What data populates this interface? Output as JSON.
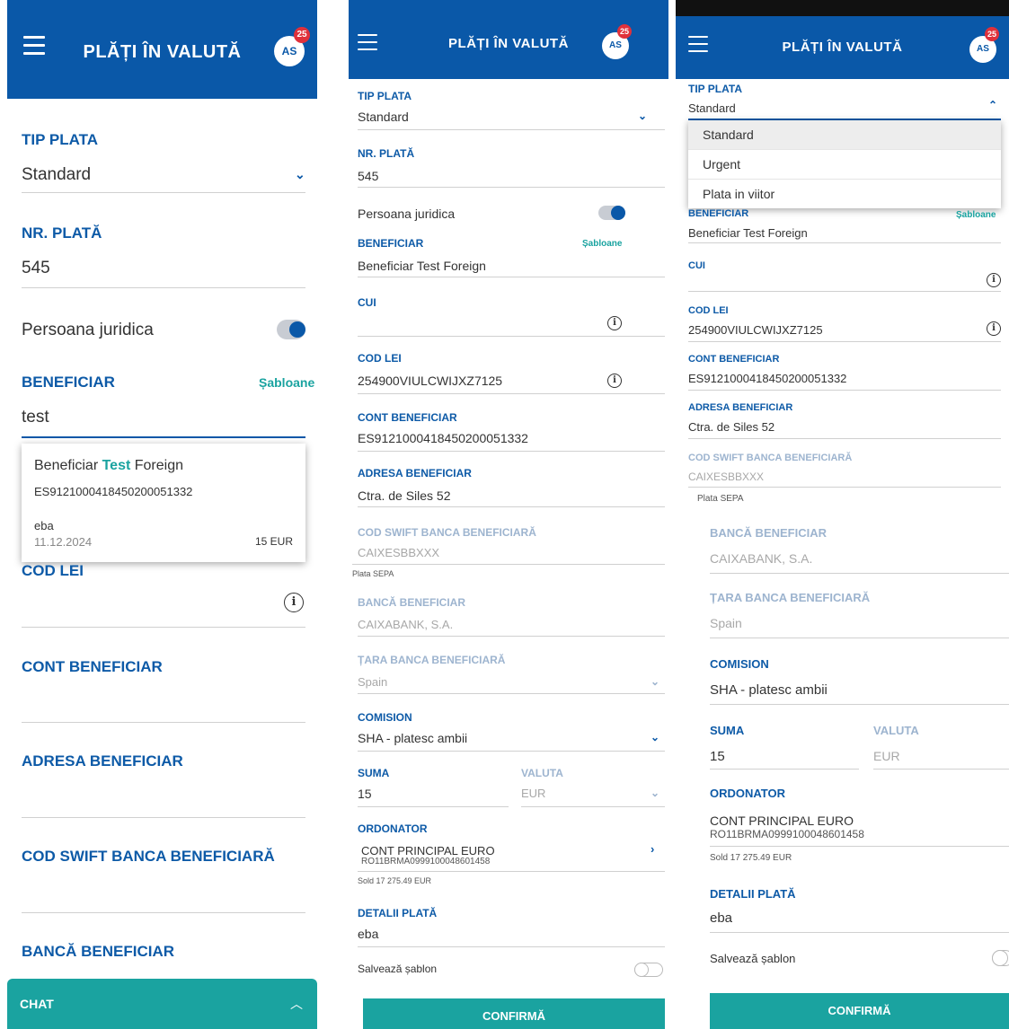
{
  "header": {
    "title": "PLĂȚI ÎN VALUTĂ",
    "avatar": "AS",
    "badge": "25"
  },
  "fields": {
    "tip_plata": {
      "label": "TIP PLATA",
      "value": "Standard"
    },
    "nr_plata": {
      "label": "NR. PLATĂ",
      "value": "545"
    },
    "persoana_juridica": {
      "label": "Persoana juridica",
      "enabled": true
    },
    "beneficiar": {
      "label": "BENEFICIAR",
      "value": "Beneficiar Test Foreign",
      "search_value": "test",
      "templates_link": "Șabloane"
    },
    "cui": {
      "label": "CUI",
      "value": ""
    },
    "cod_lei": {
      "label": "COD LEI",
      "value": "254900VIULCWIJXZ7125"
    },
    "cont_beneficiar": {
      "label": "CONT BENEFICIAR",
      "value": "ES9121000418450200051332"
    },
    "adresa_beneficiar": {
      "label": "ADRESA BENEFICIAR",
      "value": "Ctra. de Siles 52"
    },
    "cod_swift": {
      "label": "COD SWIFT BANCA BENEFICIARĂ",
      "value": "CAIXESBBXXX",
      "note": "Plata SEPA"
    },
    "banca_beneficiar": {
      "label": "BANCĂ BENEFICIAR",
      "value": "CAIXABANK, S.A."
    },
    "tara_banca": {
      "label": "ȚARA BANCA BENEFICIARĂ",
      "value": "Spain"
    },
    "comision": {
      "label": "COMISION",
      "value": "SHA - platesc ambii"
    },
    "suma": {
      "label": "SUMA",
      "value": "15"
    },
    "valuta": {
      "label": "VALUTA",
      "value": "EUR"
    },
    "ordonator": {
      "label": "ORDONATOR",
      "name": "CONT PRINCIPAL EURO",
      "iban": "RO11BRMA0999100048601458",
      "sold": "Sold 17 275.49 EUR"
    },
    "detalii": {
      "label": "DETALII PLATĂ",
      "value": "eba"
    },
    "salveaza": {
      "label": "Salvează șablon",
      "enabled": false
    }
  },
  "suggestion": {
    "prefix": "Beneficiar ",
    "highlight": "Test",
    "suffix": " Foreign",
    "iban": "ES9121000418450200051332",
    "detail": "eba",
    "date": "11.12.2024",
    "amount": "15 EUR"
  },
  "dropdown_options": [
    "Standard",
    "Urgent",
    "Plata in viitor"
  ],
  "confirm_label": "CONFIRMĂ",
  "chat": {
    "label": "CHAT"
  },
  "colors": {
    "brand": "#0a58a8",
    "accent": "#1aa3a0",
    "badge": "#e0313b"
  }
}
